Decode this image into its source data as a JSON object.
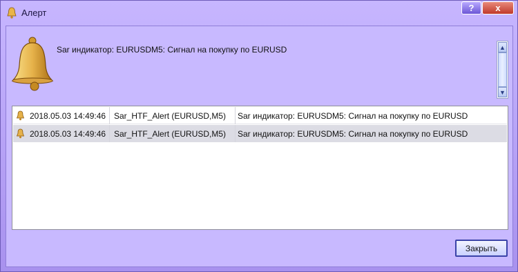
{
  "window": {
    "title": "Алерт",
    "controls": {
      "help": "?",
      "close": "x"
    }
  },
  "alert": {
    "message": "Sar индикатор: EURUSDM5: Сигнал на покупку по EURUSD"
  },
  "scrollbar": {
    "up": "▲",
    "down": "▼"
  },
  "list": {
    "rows": [
      {
        "time": "2018.05.03 14:49:46",
        "name": "Sar_HTF_Alert (EURUSD,M5)",
        "message": "Sar индикатор: EURUSDM5: Сигнал на покупку по EURUSD"
      },
      {
        "time": "2018.05.03 14:49:46",
        "name": "Sar_HTF_Alert (EURUSD,M5)",
        "message": "Sar индикатор: EURUSDM5: Сигнал на покупку по EURUSD"
      }
    ]
  },
  "buttons": {
    "close_label": "Закрыть"
  },
  "colors": {
    "window_bg": "#c8b9ff",
    "selected_row": "#dcdce4",
    "bell": "#e6b24a"
  }
}
